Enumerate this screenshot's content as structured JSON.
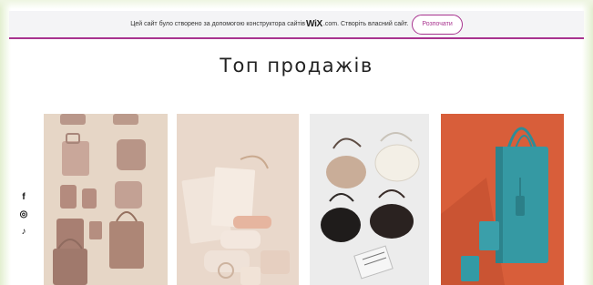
{
  "banner": {
    "text_before": "Цей сайт було створено за допомогою конструктора сайтів",
    "logo": "WiX",
    "text_after": ".com. Створіть власний сайт.",
    "button_label": "Розпочати",
    "accent_color": "#a8338f"
  },
  "page_title": "Топ продажів",
  "social_icons": [
    {
      "name": "facebook-icon",
      "glyph": "f"
    },
    {
      "name": "instagram-icon",
      "glyph": "◎"
    },
    {
      "name": "tiktok-icon",
      "glyph": "♪"
    }
  ],
  "products": [
    {
      "name": "product-image-1",
      "background": "#e6d6c6"
    },
    {
      "name": "product-image-2",
      "background": "#e9d8cb"
    },
    {
      "name": "product-image-3",
      "background": "#ececec"
    },
    {
      "name": "product-image-4",
      "background": "#d85e3a"
    }
  ]
}
